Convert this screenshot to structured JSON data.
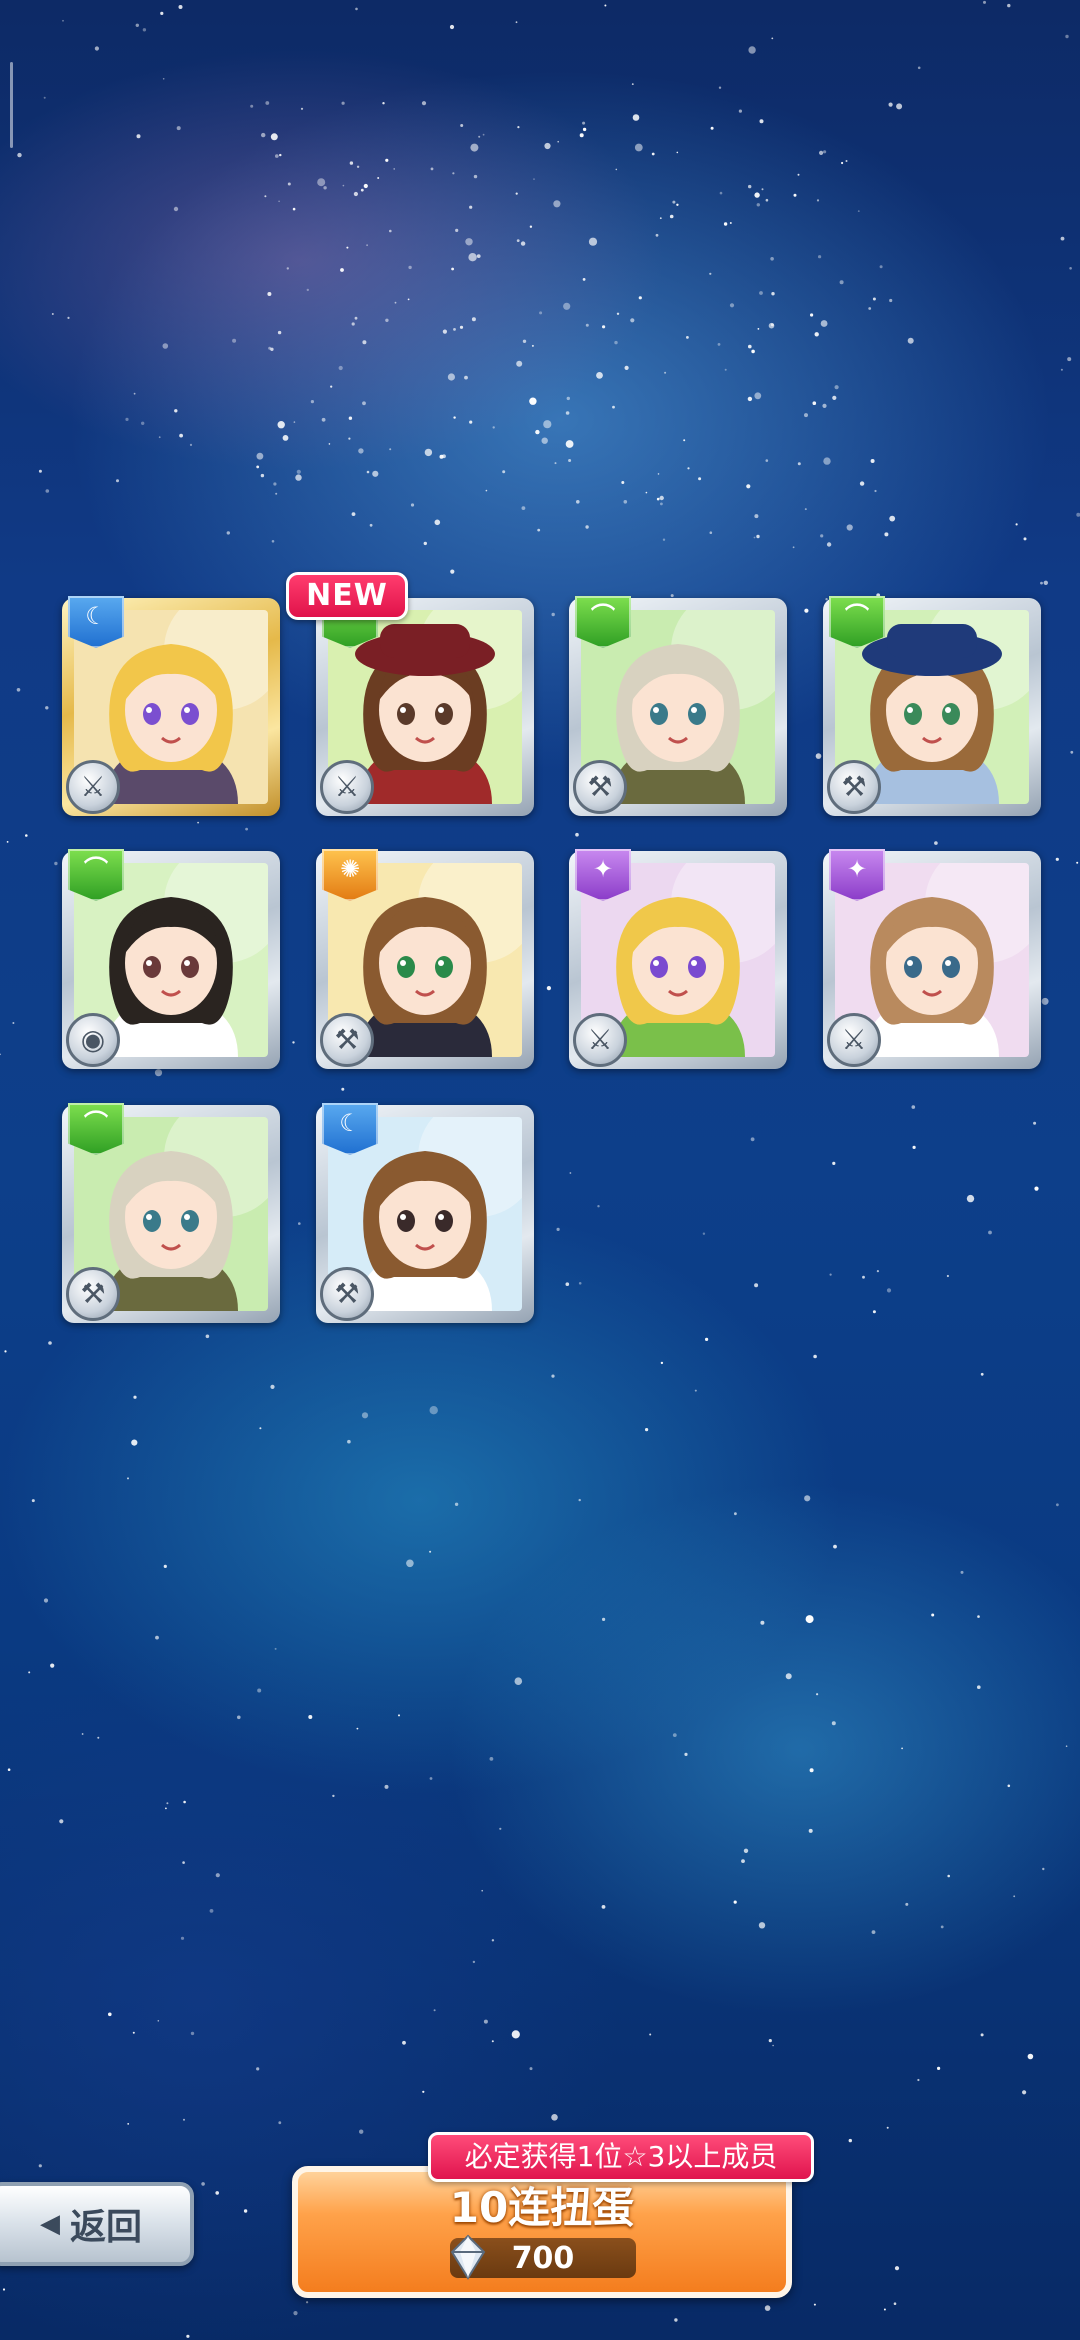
{
  "results": {
    "new_badge": "NEW",
    "cards": [
      {
        "attribute": "blue",
        "attr_icon": "moon-icon",
        "weapon_icon": "sword-icon",
        "frame": "gold",
        "hair": "#f2c64a",
        "bg": "#f5e3b0",
        "outfit": "#5a4a6a",
        "eyes": "#7b4fd0"
      },
      {
        "attribute": "green",
        "attr_icon": "leaf-icon",
        "weapon_icon": "sword-icon",
        "frame": "silver",
        "hair": "#6b3d22",
        "bg": "#d9f0b0",
        "outfit": "#a02a2a",
        "eyes": "#5a3a2a",
        "hat": "#7a1f25"
      },
      {
        "attribute": "green",
        "attr_icon": "leaf-icon",
        "weapon_icon": "hammer-icon",
        "frame": "silver",
        "hair": "#d8d2c0",
        "bg": "#c9ecb0",
        "outfit": "#6a6a3e",
        "eyes": "#3a7a8a"
      },
      {
        "attribute": "green",
        "attr_icon": "leaf-icon",
        "weapon_icon": "hammer-icon",
        "frame": "silver",
        "hair": "#9a6a3a",
        "bg": "#d2f0b8",
        "outfit": "#a6c0e0",
        "eyes": "#3a8a5a",
        "hat": "#1f3a7a"
      },
      {
        "attribute": "green",
        "attr_icon": "leaf-icon",
        "weapon_icon": "shield-icon",
        "frame": "silver",
        "hair": "#2a2420",
        "bg": "#d8f2c2",
        "outfit": "#ffffff",
        "eyes": "#6a3a3a"
      },
      {
        "attribute": "orange",
        "attr_icon": "sun-icon",
        "weapon_icon": "hammer-icon",
        "frame": "silver",
        "hair": "#8a5a30",
        "bg": "#f8e8b0",
        "outfit": "#2a2a3a",
        "eyes": "#2a8a4a"
      },
      {
        "attribute": "purple",
        "attr_icon": "star-icon",
        "weapon_icon": "sword-icon",
        "frame": "silver",
        "hair": "#f0c84a",
        "bg": "#ecd8f0",
        "outfit": "#7ac04a",
        "eyes": "#7a4ad0"
      },
      {
        "attribute": "purple",
        "attr_icon": "star-icon",
        "weapon_icon": "sword-icon",
        "frame": "silver",
        "hair": "#b98a5e",
        "bg": "#f0dcf0",
        "outfit": "#ffffff",
        "eyes": "#3a6a8a"
      },
      {
        "attribute": "green",
        "attr_icon": "leaf-icon",
        "weapon_icon": "hammer-icon",
        "frame": "silver",
        "hair": "#d8d2c0",
        "bg": "#c9ecb0",
        "outfit": "#6a6a3e",
        "eyes": "#3a7a8a"
      },
      {
        "attribute": "blue",
        "attr_icon": "moon-icon",
        "weapon_icon": "hammer-icon",
        "frame": "silver",
        "hair": "#8a5a30",
        "bg": "#d6ecf8",
        "outfit": "#ffffff",
        "eyes": "#3a2a2a"
      }
    ]
  },
  "footer": {
    "back_label": "返回",
    "guarantee_text": "必定获得1位☆3以上成员",
    "gacha_label": "10连扭蛋",
    "cost": "700"
  }
}
